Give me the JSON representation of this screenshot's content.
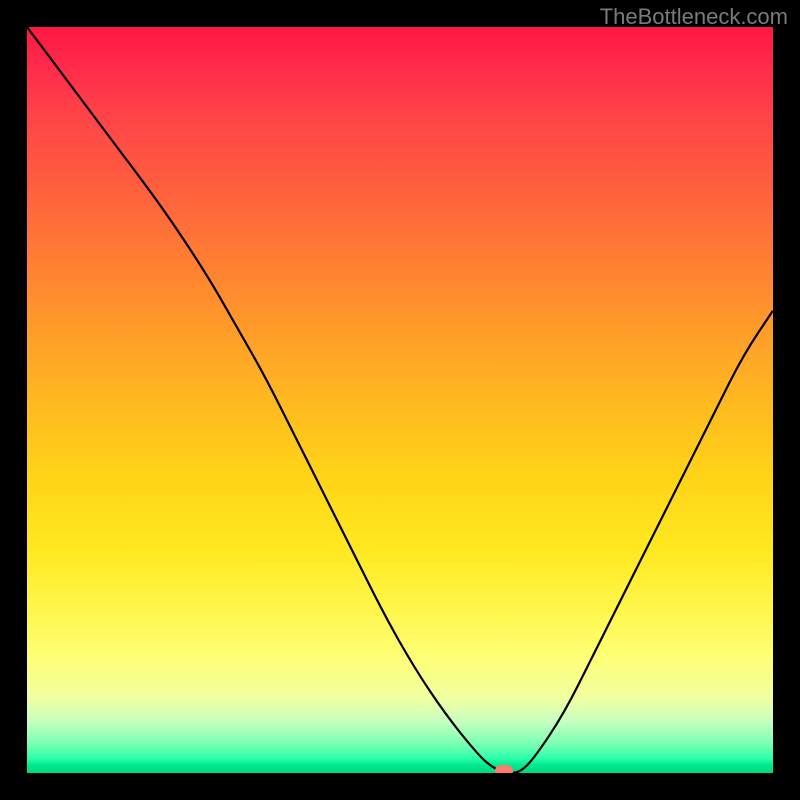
{
  "watermark": "TheBottleneck.com",
  "chart_data": {
    "type": "line",
    "title": "",
    "xlabel": "",
    "ylabel": "",
    "xlim": [
      0,
      100
    ],
    "ylim": [
      0,
      100
    ],
    "background_gradient": {
      "top": "#ff1744",
      "bottom": "#00d880",
      "meaning_top": "high",
      "meaning_bottom": "low"
    },
    "series": [
      {
        "name": "curve",
        "x": [
          0,
          6,
          12,
          18,
          24,
          28,
          32,
          36,
          40,
          44,
          48,
          52,
          56,
          60,
          62,
          64,
          66,
          68,
          72,
          76,
          80,
          84,
          88,
          92,
          96,
          100
        ],
        "y": [
          100,
          92,
          84,
          76,
          67,
          60,
          53,
          45,
          37,
          29,
          21,
          14,
          8,
          3,
          1,
          0,
          0,
          2,
          8,
          16,
          24,
          32,
          40,
          48,
          56,
          62
        ],
        "color": "#000000"
      }
    ],
    "marker": {
      "x": 64,
      "y": 0,
      "color": "#ff7a6a"
    },
    "annotations": []
  }
}
